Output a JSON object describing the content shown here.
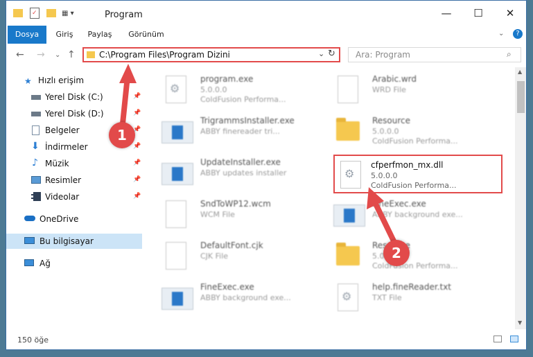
{
  "window": {
    "title": "Program"
  },
  "ribbon": {
    "tabs": [
      "Dosya",
      "Giriş",
      "Paylaş",
      "Görünüm"
    ]
  },
  "address": {
    "path": "C:\\Program Files\\Program Dizini"
  },
  "search": {
    "placeholder": "Ara: Program"
  },
  "sidebar": {
    "items": [
      {
        "label": "Hızlı erişim",
        "icon": "star-icon"
      },
      {
        "label": "Yerel Disk (C:)",
        "icon": "drive-icon"
      },
      {
        "label": "Yerel Disk (D:)",
        "icon": "drive-icon"
      },
      {
        "label": "Belgeler",
        "icon": "documents-icon"
      },
      {
        "label": "İndirmeler",
        "icon": "downloads-icon"
      },
      {
        "label": "Müzik",
        "icon": "music-icon"
      },
      {
        "label": "Resimler",
        "icon": "pictures-icon"
      },
      {
        "label": "Videolar",
        "icon": "videos-icon"
      },
      {
        "label": "OneDrive",
        "icon": "cloud-icon"
      },
      {
        "label": "Bu bilgisayar",
        "icon": "computer-icon"
      },
      {
        "label": "Ağ",
        "icon": "network-icon"
      }
    ]
  },
  "files": [
    {
      "name": "program.exe",
      "line1": "5.0.0.0",
      "line2": "ColdFusion Performa..."
    },
    {
      "name": "Arabic.wrd",
      "line1": "WRD File",
      "line2": ""
    },
    {
      "name": "TrigrammsInstaller.exe",
      "line1": "ABBY finereader tri...",
      "line2": ""
    },
    {
      "name": "Resource",
      "line1": "5.0.0.0",
      "line2": "ColdFusion Performa..."
    },
    {
      "name": "UpdateInstaller.exe",
      "line1": "ABBY updates installer",
      "line2": ""
    },
    {
      "name": "cfperfmon_mx.dll",
      "line1": "5.0.0.0",
      "line2": "ColdFusion Performa..."
    },
    {
      "name": "SndToWP12.wcm",
      "line1": "WCM File",
      "line2": ""
    },
    {
      "name": "FineExec.exe",
      "line1": "ABBY background exe...",
      "line2": ""
    },
    {
      "name": "DefaultFont.cjk",
      "line1": "CJK File",
      "line2": ""
    },
    {
      "name": "Resource",
      "line1": "5.0.0.0",
      "line2": "ColdFusion Performa..."
    },
    {
      "name": "FineExec.exe",
      "line1": "ABBY background exe...",
      "line2": ""
    },
    {
      "name": "help.fineReader.txt",
      "line1": "TXT File",
      "line2": ""
    }
  ],
  "status": {
    "count": "150 öğe"
  },
  "annotations": {
    "step1": "1",
    "step2": "2",
    "color": "#e24a4a"
  }
}
